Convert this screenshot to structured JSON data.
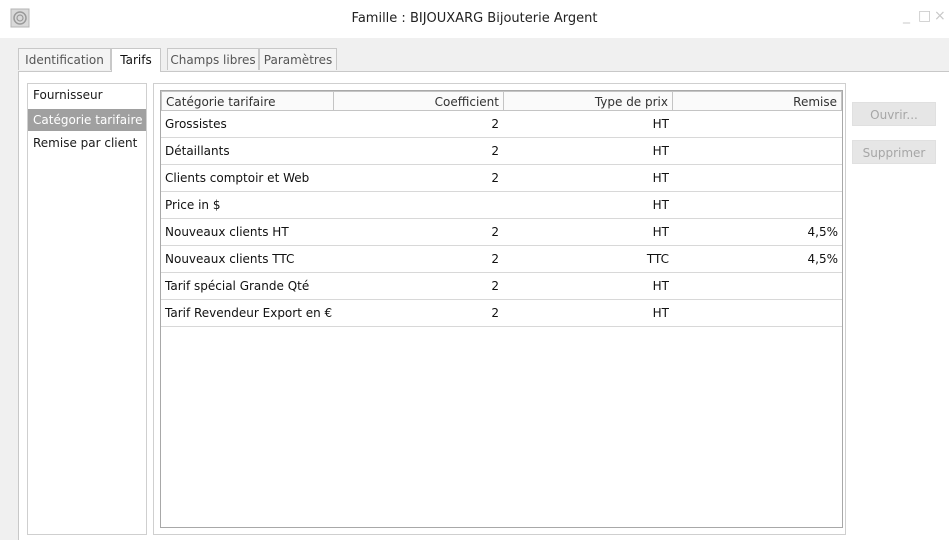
{
  "window": {
    "title": "Famille : BIJOUXARG Bijouterie Argent",
    "minimize_glyph": "_",
    "maximize_glyph": "□",
    "close_glyph": "×"
  },
  "tabs": [
    {
      "label": "Identification",
      "active": false
    },
    {
      "label": "Tarifs",
      "active": true
    },
    {
      "label": "Champs libres",
      "active": false
    },
    {
      "label": "Paramètres",
      "active": false
    }
  ],
  "nav": {
    "items": [
      {
        "label": "Fournisseur",
        "selected": false
      },
      {
        "label": "Catégorie tarifaire",
        "selected": true
      },
      {
        "label": "Remise par client",
        "selected": false
      }
    ]
  },
  "table": {
    "columns": [
      "Catégorie tarifaire",
      "Coefficient",
      "Type de prix",
      "Remise"
    ],
    "rows": [
      [
        "Grossistes",
        "2",
        "HT",
        ""
      ],
      [
        "Détaillants",
        "2",
        "HT",
        ""
      ],
      [
        "Clients comptoir et  Web",
        "2",
        "HT",
        ""
      ],
      [
        "Price in $",
        "",
        "HT",
        ""
      ],
      [
        "Nouveaux clients HT",
        "2",
        "HT",
        "4,5%"
      ],
      [
        "Nouveaux clients TTC",
        "2",
        "TTC",
        "4,5%"
      ],
      [
        "Tarif spécial Grande Qté",
        "2",
        "HT",
        ""
      ],
      [
        "Tarif Revendeur Export en €",
        "2",
        "HT",
        ""
      ]
    ]
  },
  "buttons": {
    "open": "Ouvrir...",
    "delete": "Supprimer"
  },
  "colors": {
    "selected_nav_bg": "#a0a0a0",
    "disabled_button_text": "#a6a6a6"
  }
}
